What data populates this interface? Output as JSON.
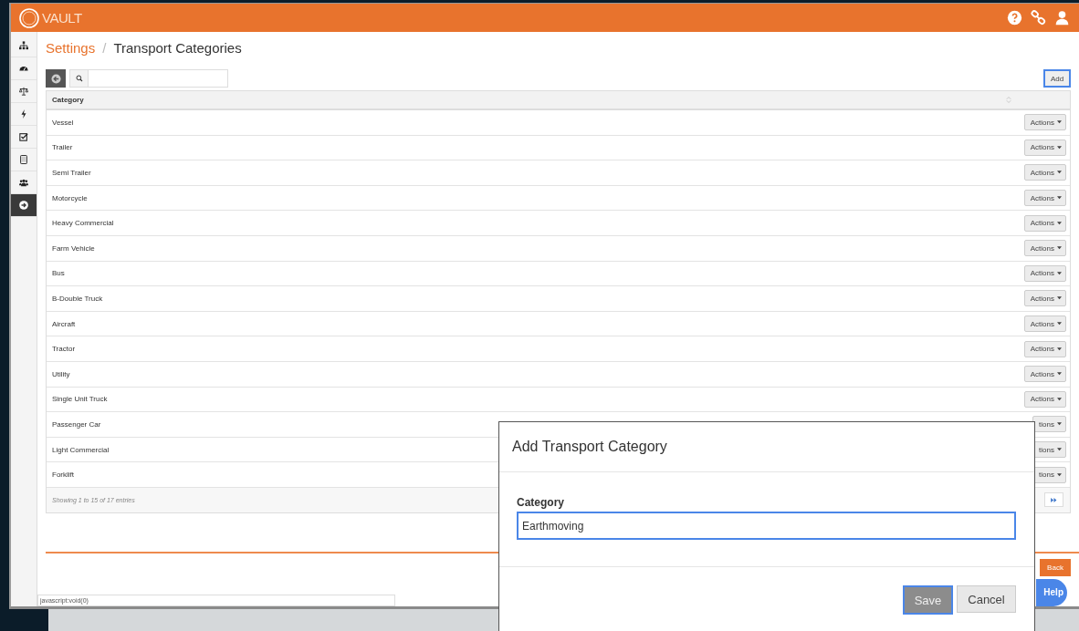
{
  "header": {
    "logo": "VAULT"
  },
  "sidebar": {
    "items": [
      {
        "selected": false
      },
      {
        "selected": false
      },
      {
        "selected": false
      },
      {
        "selected": false
      },
      {
        "selected": false
      },
      {
        "selected": false
      },
      {
        "selected": false
      },
      {
        "selected": true
      }
    ]
  },
  "breadcrumb": {
    "parent": "Settings",
    "separator": "/",
    "current": "Transport Categories"
  },
  "toolbar": {
    "add_button": "Add"
  },
  "table": {
    "columns": [
      "Category"
    ],
    "rows": [
      {
        "category": "Vessel",
        "action": "Actions"
      },
      {
        "category": "Trailer",
        "action": "Actions"
      },
      {
        "category": "Semi Trailer",
        "action": "Actions"
      },
      {
        "category": "Motorcycle",
        "action": "Actions"
      },
      {
        "category": "Heavy Commercial",
        "action": "Actions"
      },
      {
        "category": "Farm Vehicle",
        "action": "Actions"
      },
      {
        "category": "Bus",
        "action": "Actions"
      },
      {
        "category": "B-Double Truck",
        "action": "Actions"
      },
      {
        "category": "Aircraft",
        "action": "Actions"
      },
      {
        "category": "Tractor",
        "action": "Actions"
      },
      {
        "category": "Utility",
        "action": "Actions"
      },
      {
        "category": "Single Unit Truck",
        "action": "Actions"
      },
      {
        "category": "Passenger Car",
        "action": "tions"
      },
      {
        "category": "Light Commercial",
        "action": "tions"
      },
      {
        "category": "Forklift",
        "action": "tions"
      }
    ],
    "info": "Showing 1 to 15 of 17 entries"
  },
  "footer": {
    "back_button": "Back",
    "help_button": "Help"
  },
  "status_bar": "javascript:void(0)",
  "dialog": {
    "title": "Add Transport Category",
    "field_label": "Category",
    "field_value": "Earthmoving",
    "save_button": "Save",
    "cancel_button": "Cancel"
  }
}
